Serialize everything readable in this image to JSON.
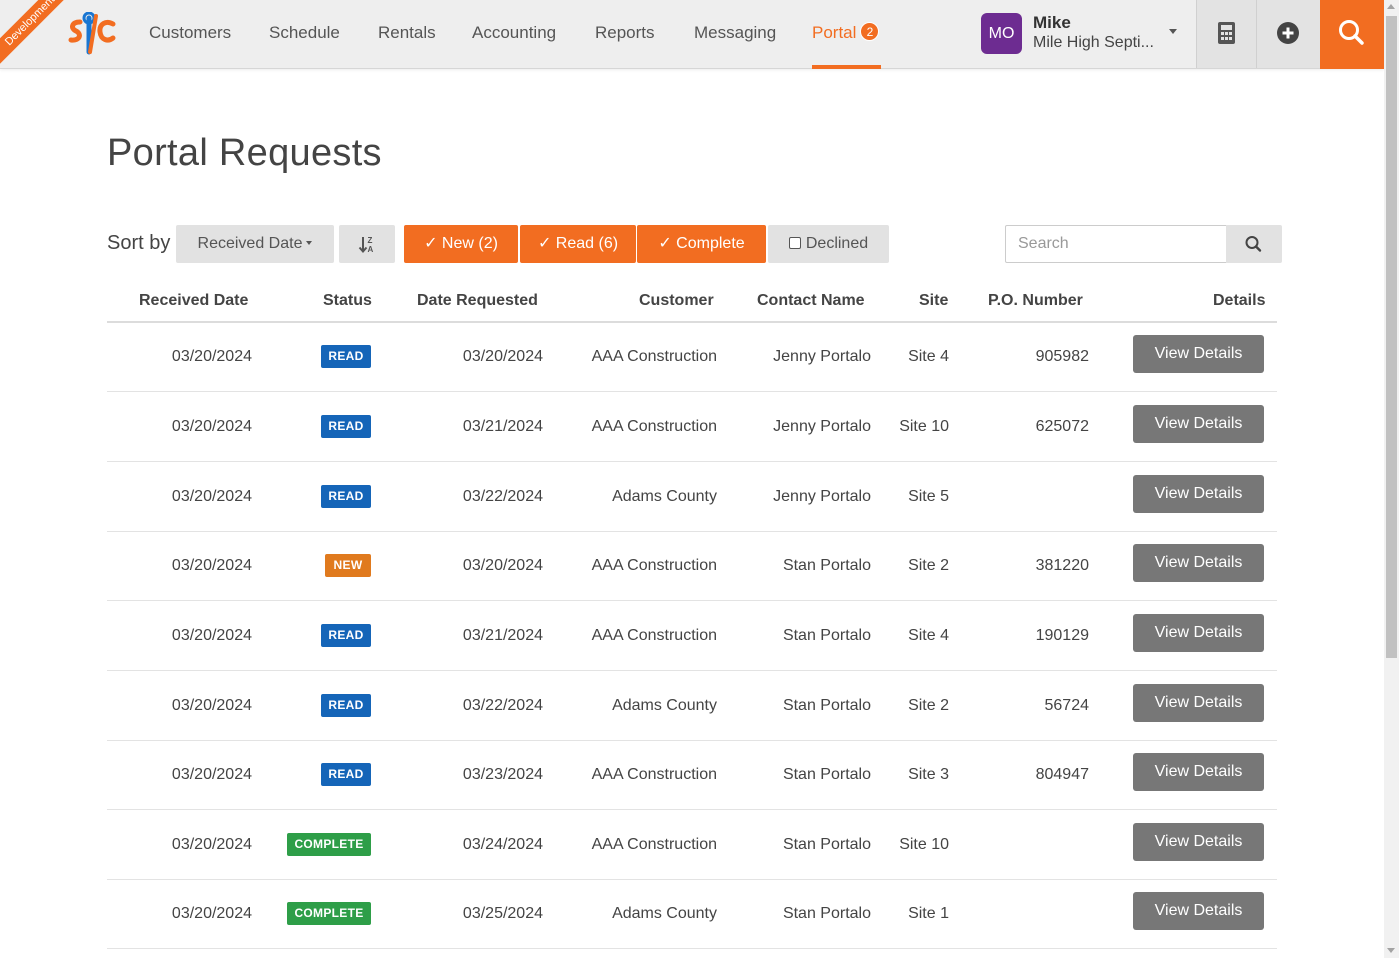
{
  "env_ribbon": "Development",
  "nav": {
    "items": [
      "Customers",
      "Schedule",
      "Rentals",
      "Accounting",
      "Reports",
      "Messaging"
    ],
    "active": {
      "label": "Portal",
      "badge": "2"
    }
  },
  "user": {
    "initials": "MO",
    "name": "Mike",
    "org": "Mile High Septi..."
  },
  "page": {
    "title": "Portal Requests"
  },
  "toolbar": {
    "sort_label": "Sort by",
    "sort_value": "Received Date",
    "filters": {
      "new": "✓ New (2)",
      "read": "✓ Read (6)",
      "complete": "✓ Complete",
      "declined": "Declined"
    },
    "search_placeholder": "Search"
  },
  "table": {
    "columns": [
      "Received Date",
      "Status",
      "Date Requested",
      "Customer",
      "Contact Name",
      "Site",
      "P.O. Number",
      "Details"
    ],
    "button_label": "View Details",
    "rows": [
      {
        "received": "03/20/2024",
        "status": "READ",
        "requested": "03/20/2024",
        "customer": "AAA Construction",
        "contact": "Jenny Portalo",
        "site": "Site 4",
        "po": "905982"
      },
      {
        "received": "03/20/2024",
        "status": "READ",
        "requested": "03/21/2024",
        "customer": "AAA Construction",
        "contact": "Jenny Portalo",
        "site": "Site 10",
        "po": "625072"
      },
      {
        "received": "03/20/2024",
        "status": "READ",
        "requested": "03/22/2024",
        "customer": "Adams County",
        "contact": "Jenny Portalo",
        "site": "Site 5",
        "po": ""
      },
      {
        "received": "03/20/2024",
        "status": "NEW",
        "requested": "03/20/2024",
        "customer": "AAA Construction",
        "contact": "Stan Portalo",
        "site": "Site 2",
        "po": "381220"
      },
      {
        "received": "03/20/2024",
        "status": "READ",
        "requested": "03/21/2024",
        "customer": "AAA Construction",
        "contact": "Stan Portalo",
        "site": "Site 4",
        "po": "190129"
      },
      {
        "received": "03/20/2024",
        "status": "READ",
        "requested": "03/22/2024",
        "customer": "Adams County",
        "contact": "Stan Portalo",
        "site": "Site 2",
        "po": "56724"
      },
      {
        "received": "03/20/2024",
        "status": "READ",
        "requested": "03/23/2024",
        "customer": "AAA Construction",
        "contact": "Stan Portalo",
        "site": "Site 3",
        "po": "804947"
      },
      {
        "received": "03/20/2024",
        "status": "COMPLETE",
        "requested": "03/24/2024",
        "customer": "AAA Construction",
        "contact": "Stan Portalo",
        "site": "Site 10",
        "po": ""
      },
      {
        "received": "03/20/2024",
        "status": "COMPLETE",
        "requested": "03/25/2024",
        "customer": "Adams County",
        "contact": "Stan Portalo",
        "site": "Site 1",
        "po": ""
      }
    ]
  },
  "colors": {
    "accent": "#f26d21",
    "read": "#1565b8",
    "new": "#e07a1e",
    "complete": "#2e9e48",
    "button": "#777777"
  }
}
